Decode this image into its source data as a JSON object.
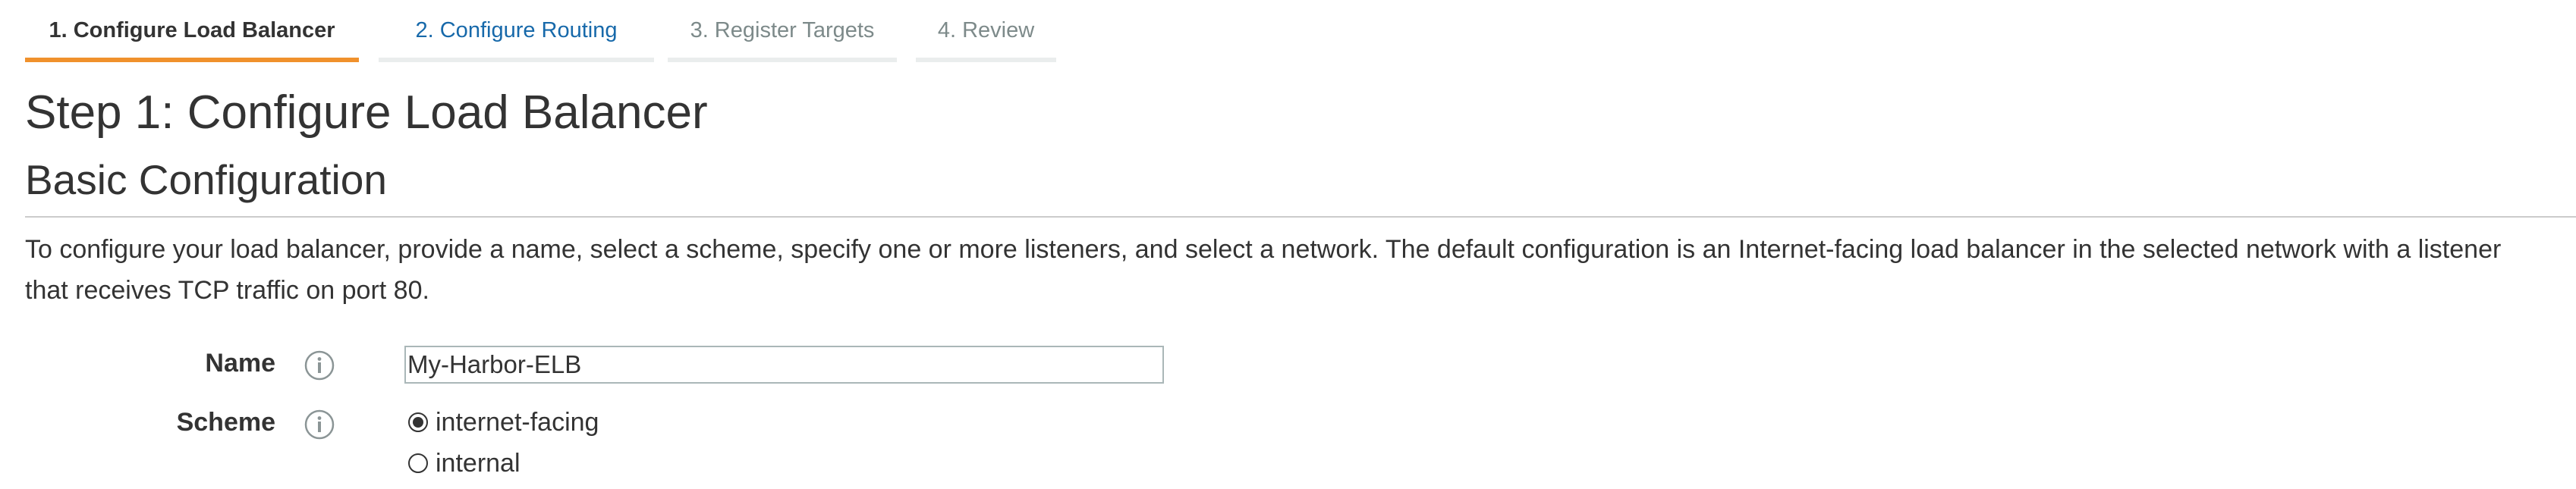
{
  "wizard": {
    "tabs": [
      {
        "label": "1. Configure Load Balancer",
        "state": "active"
      },
      {
        "label": "2. Configure Routing",
        "state": "link"
      },
      {
        "label": "3. Register Targets",
        "state": "disabled"
      },
      {
        "label": "4. Review",
        "state": "disabled"
      }
    ],
    "colors": {
      "active_underline": "#f0912c",
      "inactive_underline": "#eaeded",
      "link": "#1769aa",
      "disabled_text": "#7d8a8a"
    }
  },
  "page": {
    "step_title": "Step 1: Configure Load Balancer",
    "section_title": "Basic Configuration",
    "description_lines": [
      "To configure your load balancer, provide a name, select a scheme, specify one or more listeners, and select a network. The default configuration is an Internet-facing load balancer in the selected network with a listener",
      "that receives TCP traffic on port 80."
    ]
  },
  "form": {
    "name": {
      "label": "Name",
      "icon": "info-icon",
      "value": "My-Harbor-ELB"
    },
    "scheme": {
      "label": "Scheme",
      "icon": "info-icon",
      "options": [
        {
          "label": "internet-facing",
          "selected": true
        },
        {
          "label": "internal",
          "selected": false
        }
      ]
    }
  }
}
